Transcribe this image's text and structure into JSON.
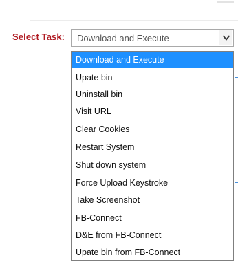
{
  "form": {
    "label": "Select Task:",
    "selected_value": "Download and Execute",
    "options": [
      "Download and Execute",
      "Upate bin",
      "Uninstall bin",
      "Visit URL",
      "Clear Cookies",
      "Restart System",
      "Shut down system",
      "Force Upload Keystroke",
      "Take Screenshot",
      "FB-Connect",
      "D&E from FB-Connect",
      "Upate bin from FB-Connect"
    ]
  },
  "colors": {
    "label": "#b01b23",
    "highlight": "#1e90ff"
  },
  "icons": {
    "dropdown_arrow": "chevron-down-icon"
  }
}
